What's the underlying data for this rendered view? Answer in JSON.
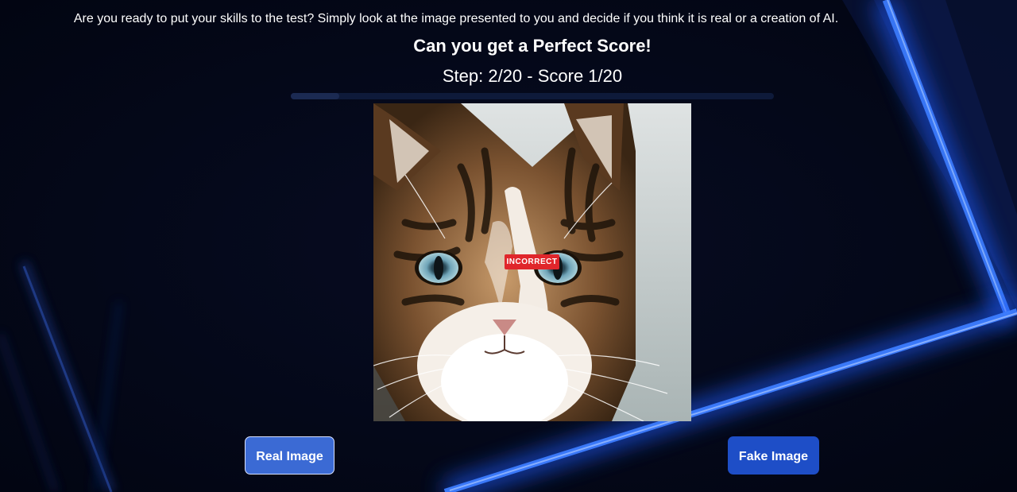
{
  "intro_text": "Are you ready to put your skills to the test? Simply look at the image presented to you and decide if you think it is real or a creation of AI.",
  "title": "Can you get a Perfect Score!",
  "status": "Step: 2/20 - Score 1/20",
  "progress": {
    "step": 2,
    "total_steps": 20,
    "fraction": 0.1
  },
  "quiz_image": {
    "subject": "tabby cat face close-up",
    "result_badge": "INCORRECT"
  },
  "buttons": {
    "real_label": "Real Image",
    "fake_label": "Fake Image"
  },
  "colors": {
    "background": "#05091c",
    "accent_line": "#2f6fff",
    "badge_red": "#e0262b",
    "real_button": "#3b6ad4",
    "fake_button": "#1e4ec7"
  }
}
